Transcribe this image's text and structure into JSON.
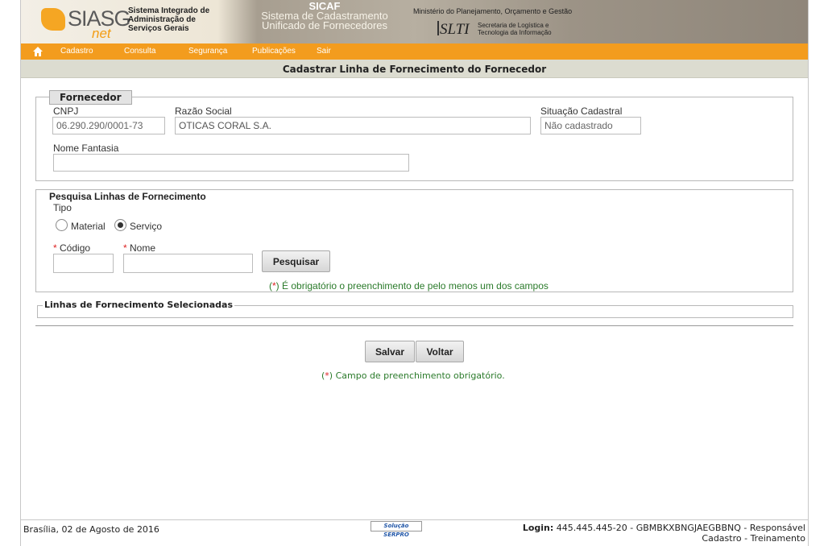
{
  "header": {
    "logo_text": "SIASG",
    "logo_net": "net",
    "system_name": [
      "Sistema Integrado de",
      "Administração de",
      "Serviços Gerais"
    ],
    "sicaf_title": "SICAF",
    "sicaf_subtitle": [
      "Sistema de Cadastramento",
      "Unificado de Fornecedores"
    ],
    "ministry": "Ministério do Planejamento, Orçamento e Gestão",
    "slti_logo": "SLTI",
    "slti_text": [
      "Secretaria de Logística e",
      "Tecnologia da Informação"
    ]
  },
  "menu": {
    "items": [
      "Cadastro",
      "Consulta",
      "Segurança",
      "Publicações",
      "Sair"
    ]
  },
  "page_title": "Cadastrar Linha de Fornecimento do Fornecedor",
  "fornecedor": {
    "legend": "Fornecedor",
    "cnpj_label": "CNPJ",
    "cnpj_value": "06.290.290/0001-73",
    "razao_label": "Razão Social",
    "razao_value": "OTICAS CORAL S.A.",
    "situacao_label": "Situação Cadastral",
    "situacao_value": "Não cadastrado",
    "fantasia_label": "Nome Fantasia",
    "fantasia_value": ""
  },
  "pesquisa": {
    "legend": "Pesquisa Linhas de Fornecimento",
    "tipo_label": "Tipo",
    "tipo_options": [
      "Material",
      "Serviço"
    ],
    "tipo_selected": "Serviço",
    "codigo_label": "Código",
    "nome_label": "Nome",
    "codigo_value": "",
    "nome_value": "",
    "search_button": "Pesquisar",
    "required_note": "É obrigatório o preenchimento de pelo menos um dos campos",
    "asterisk": "*"
  },
  "selecionadas": {
    "legend": "Linhas de Fornecimento Selecionadas"
  },
  "actions": {
    "save_button": "Salvar",
    "back_button": "Voltar",
    "required_note": "Campo de preenchimento obrigatório."
  },
  "footer": {
    "date": "Brasília, 02 de Agosto de 2016",
    "serpro": "Solução SERPRO",
    "login_label": "Login:",
    "login_value": "445.445.445-20 - GBMBKXBNGJAEGBBNQ - Responsável",
    "login_line2": "Cadastro - Treinamento"
  },
  "colors": {
    "menu_bar": "#f39c1e",
    "title_bar": "#dcdcd0",
    "note_green": "#2a7a2a",
    "required_red": "#d22222"
  }
}
